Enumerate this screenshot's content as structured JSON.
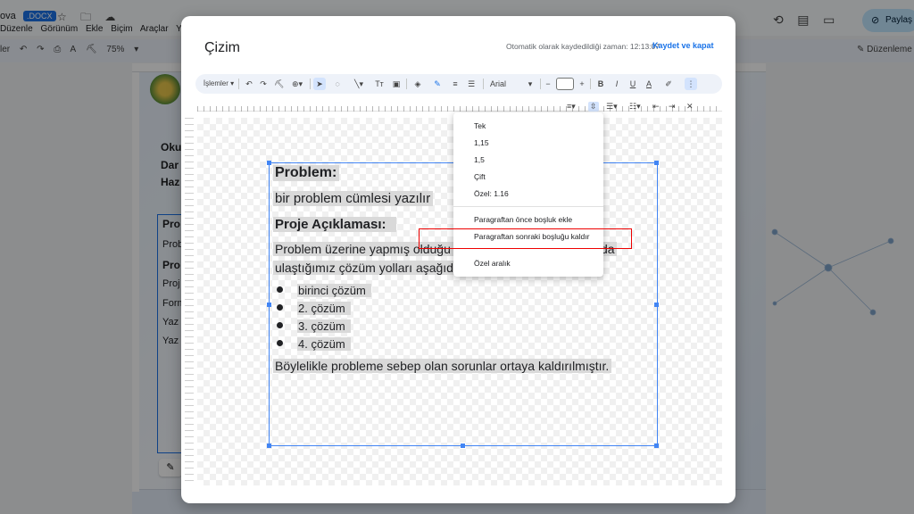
{
  "background_app": {
    "doc_title": "ova",
    "doc_badge": ".DOCX",
    "title_icons": "☆ 🗀 ☁",
    "menu": [
      "Düzenle",
      "Görünüm",
      "Ekle",
      "Biçim",
      "Araçlar",
      "Ya"
    ],
    "toolbar_left": [
      "ler",
      "↶",
      "↷",
      "⎙",
      "A",
      "⛏",
      "75%",
      "▾"
    ],
    "share_label": "Paylaş",
    "edit_mode_label": "Düzenleme",
    "page_text": [
      "Oku",
      "Dar",
      "Haz"
    ],
    "page_box_text": [
      "Pro",
      "Prob",
      "Pro",
      "Proj",
      "Form",
      "Yaz",
      "Yaz"
    ]
  },
  "dialog": {
    "title": "Çizim",
    "autosave_text": "Otomatik olarak kaydedildiği zaman: 12:13:07",
    "save_close_label": "Kaydet ve kapat",
    "toolbar": {
      "actions_label": "İşlemler ▾",
      "font_name": "Arial",
      "font_minus": "−",
      "font_plus": "+",
      "bold": "B",
      "italic": "I",
      "underline": "U",
      "text_color": "A",
      "more": "⋮"
    }
  },
  "canvas_content": {
    "heading_problem": "Problem:",
    "problem_line": "bir problem cümlesi yazılır",
    "heading_project": "Proje Açıklaması:",
    "desc_line1_a": "Problem üzerine yapmış olduğu",
    "desc_line1_b": "da",
    "desc_line2": "ulaştığımız çözüm yolları aşağıd",
    "bullets": [
      "birinci çözüm",
      "2. çözüm",
      "3. çözüm",
      "4. çözüm"
    ],
    "closing_line": "Böylelikle probleme sebep olan sorunlar ortaya kaldırılmıştır."
  },
  "line_spacing_menu": {
    "options": [
      "Tek",
      "1,15",
      "1,5",
      "Çift",
      "Özel: 1.16"
    ],
    "add_before": "Paragraftan önce boşluk ekle",
    "remove_after": "Paragraftan sonraki boşluğu kaldır",
    "custom": "Özel aralık"
  },
  "colors": {
    "accent": "#1a73e8",
    "highlight_border": "#e00000"
  }
}
